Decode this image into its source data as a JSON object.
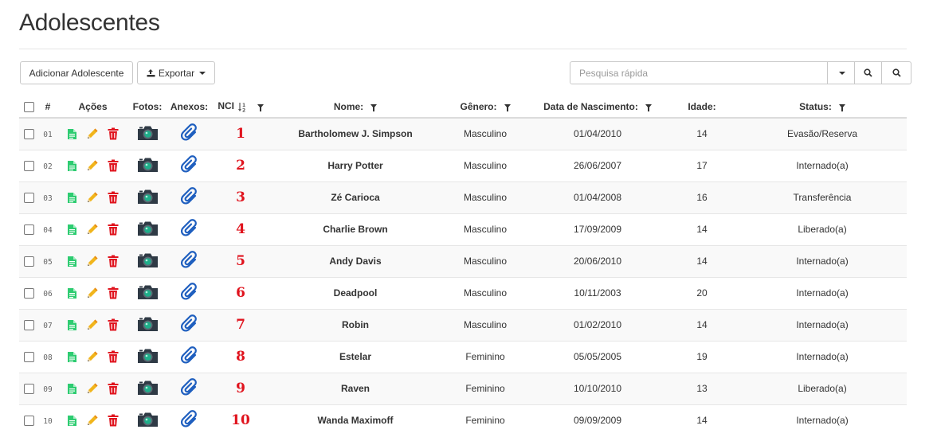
{
  "page": {
    "title": "Adolescentes"
  },
  "toolbar": {
    "add_label": "Adicionar Adolescente",
    "export_label": "Exportar"
  },
  "search": {
    "placeholder": "Pesquisa rápida"
  },
  "table": {
    "headers": {
      "num": "#",
      "acoes": "Ações",
      "fotos": "Fotos:",
      "anexos": "Anexos:",
      "nci": "NCI",
      "nome": "Nome:",
      "genero": "Gênero:",
      "nascimento": "Data de Nascimento:",
      "idade": "Idade:",
      "status": "Status:"
    },
    "rows": [
      {
        "num": "01",
        "nci": "1",
        "nome": "Bartholomew J. Simpson",
        "genero": "Masculino",
        "nascimento": "01/04/2010",
        "idade": "14",
        "status": "Evasão/Reserva"
      },
      {
        "num": "02",
        "nci": "2",
        "nome": "Harry Potter",
        "genero": "Masculino",
        "nascimento": "26/06/2007",
        "idade": "17",
        "status": "Internado(a)"
      },
      {
        "num": "03",
        "nci": "3",
        "nome": "Zé Carioca",
        "genero": "Masculino",
        "nascimento": "01/04/2008",
        "idade": "16",
        "status": "Transferência"
      },
      {
        "num": "04",
        "nci": "4",
        "nome": "Charlie Brown",
        "genero": "Masculino",
        "nascimento": "17/09/2009",
        "idade": "14",
        "status": "Liberado(a)"
      },
      {
        "num": "05",
        "nci": "5",
        "nome": "Andy Davis",
        "genero": "Masculino",
        "nascimento": "20/06/2010",
        "idade": "14",
        "status": "Internado(a)"
      },
      {
        "num": "06",
        "nci": "6",
        "nome": "Deadpool",
        "genero": "Masculino",
        "nascimento": "10/11/2003",
        "idade": "20",
        "status": "Internado(a)"
      },
      {
        "num": "07",
        "nci": "7",
        "nome": "Robin",
        "genero": "Masculino",
        "nascimento": "01/02/2010",
        "idade": "14",
        "status": "Internado(a)"
      },
      {
        "num": "08",
        "nci": "8",
        "nome": "Estelar",
        "genero": "Feminino",
        "nascimento": "05/05/2005",
        "idade": "19",
        "status": "Internado(a)"
      },
      {
        "num": "09",
        "nci": "9",
        "nome": "Raven",
        "genero": "Feminino",
        "nascimento": "10/10/2010",
        "idade": "13",
        "status": "Liberado(a)"
      },
      {
        "num": "10",
        "nci": "10",
        "nome": "Wanda Maximoff",
        "genero": "Feminino",
        "nascimento": "09/09/2009",
        "idade": "14",
        "status": "Internado(a)"
      }
    ]
  },
  "icons": {
    "view": "file-icon",
    "edit": "pencil-icon",
    "delete": "trash-icon",
    "photo": "camera-icon",
    "attachment": "paperclip-icon",
    "sort": "sort-numeric-icon",
    "filter": "filter-icon",
    "export": "export-icon",
    "search": "search-icon"
  },
  "colors": {
    "nci": "#e0141e",
    "view_icon": "#2ecc71",
    "edit_icon": "#f1b51c",
    "delete_icon": "#e0141e",
    "attachment_icon": "#1f5fbf",
    "camera_icon": "#2f3a45",
    "stripe": "#f9f9f9"
  }
}
